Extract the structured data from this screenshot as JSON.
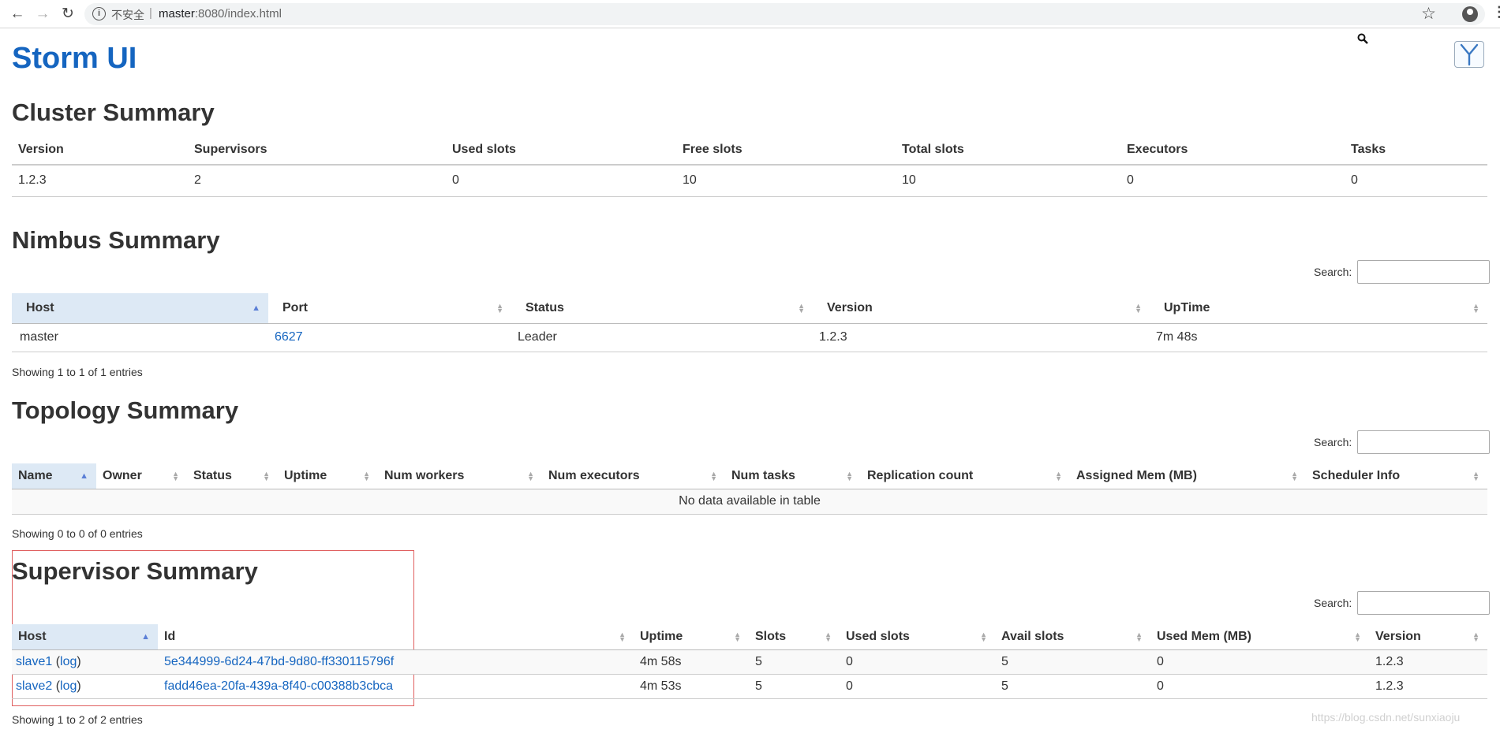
{
  "browser": {
    "insecure_label": "不安全",
    "url_host": "master",
    "url_rest": ":8080/index.html"
  },
  "app": {
    "title": "Storm UI"
  },
  "cluster": {
    "heading": "Cluster Summary",
    "columns": [
      "Version",
      "Supervisors",
      "Used slots",
      "Free slots",
      "Total slots",
      "Executors",
      "Tasks"
    ],
    "row": [
      "1.2.3",
      "2",
      "0",
      "10",
      "10",
      "0",
      "0"
    ]
  },
  "nimbus": {
    "heading": "Nimbus Summary",
    "search_label": "Search:",
    "columns": [
      "Host",
      "Port",
      "Status",
      "Version",
      "UpTime"
    ],
    "row": {
      "host": "master",
      "port": "6627",
      "status": "Leader",
      "version": "1.2.3",
      "uptime": "7m 48s"
    },
    "entries": "Showing 1 to 1 of 1 entries"
  },
  "topology": {
    "heading": "Topology Summary",
    "search_label": "Search:",
    "columns": [
      "Name",
      "Owner",
      "Status",
      "Uptime",
      "Num workers",
      "Num executors",
      "Num tasks",
      "Replication count",
      "Assigned Mem (MB)",
      "Scheduler Info"
    ],
    "empty": "No data available in table",
    "entries": "Showing 0 to 0 of 0 entries"
  },
  "supervisor": {
    "heading": "Supervisor Summary",
    "search_label": "Search:",
    "columns": [
      "Host",
      "Id",
      "Uptime",
      "Slots",
      "Used slots",
      "Avail slots",
      "Used Mem (MB)",
      "Version"
    ],
    "rows": [
      {
        "host": "slave1",
        "log": "log",
        "id": "5e344999-6d24-47bd-9d80-ff330115796f",
        "uptime": "4m 58s",
        "slots": "5",
        "used": "0",
        "avail": "5",
        "mem": "0",
        "version": "1.2.3"
      },
      {
        "host": "slave2",
        "log": "log",
        "id": "fadd46ea-20fa-439a-8f40-c00388b3cbca",
        "uptime": "4m 53s",
        "slots": "5",
        "used": "0",
        "avail": "5",
        "mem": "0",
        "version": "1.2.3"
      }
    ],
    "entries": "Showing 1 to 2 of 2 entries"
  },
  "watermark": "https://blog.csdn.net/sunxiaoju"
}
